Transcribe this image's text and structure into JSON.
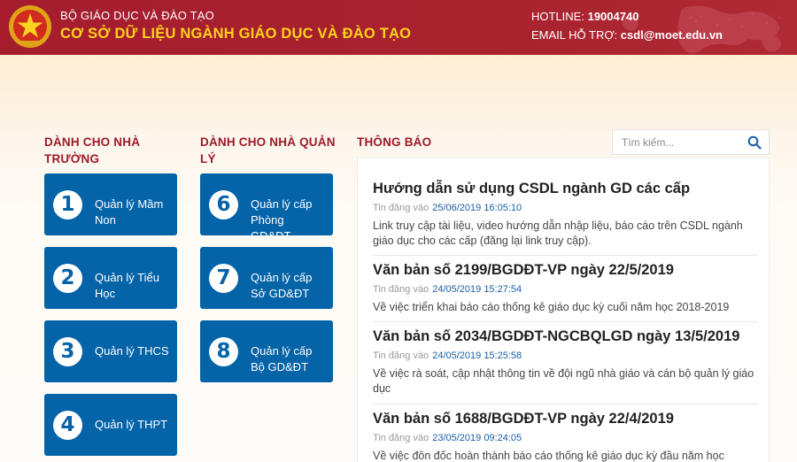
{
  "header": {
    "ministry": "BỘ GIÁO DỤC VÀ ĐÀO TẠO",
    "title": "CƠ SỞ DỮ LIỆU NGÀNH GIÁO DỤC VÀ ĐÀO TẠO",
    "hotline_label": "HOTLINE:",
    "hotline_value": "19004740",
    "email_label": "EMAIL HỖ TRỢ:",
    "email_value": "csdl@moet.edu.vn"
  },
  "schools": {
    "heading_line1": "DÀNH CHO NHÀ",
    "heading_line2": "TRƯỜNG",
    "items": [
      {
        "num": "1",
        "line1": "Quản lý Mầm",
        "line2": "Non"
      },
      {
        "num": "2",
        "line1": "Quản lý Tiểu",
        "line2": "Học"
      },
      {
        "num": "3",
        "line1": "Quản lý THCS",
        "line2": ""
      },
      {
        "num": "4",
        "line1": "Quản lý THPT",
        "line2": ""
      }
    ]
  },
  "management": {
    "heading_line1": "DÀNH CHO NHÀ QUẢN",
    "heading_line2": "LÝ",
    "items": [
      {
        "num": "6",
        "line1": "Quản lý cấp",
        "line2": "Phòng",
        "line3": "GD&ĐT"
      },
      {
        "num": "7",
        "line1": "Quản lý cấp",
        "line2": "Sở GD&ĐT"
      },
      {
        "num": "8",
        "line1": "Quản lý cấp",
        "line2": "Bộ GD&ĐT"
      }
    ]
  },
  "news": {
    "heading": "THÔNG BÁO",
    "search_placeholder": "Tìm kiếm...",
    "posted_label": "Tin đăng vào",
    "items": [
      {
        "title": "Hướng dẫn sử dụng CSDL ngành GD các cấp",
        "date": "25/06/2019 16:05:10",
        "desc_line1": "Link truy cập tài liệu, video hướng dẫn nhập liệu, báo cáo trên CSDL ngành",
        "desc_line2": "giáo dục cho các cấp (đăng lại link truy cập)."
      },
      {
        "title": "Văn bản số 2199/BGDĐT-VP ngày 22/5/2019",
        "date": "24/05/2019 15:27:54",
        "desc_line1": "Về việc triển khai báo cáo thống kê giáo dục kỳ cuối năm học 2018-2019",
        "desc_line2": ""
      },
      {
        "title": "Văn bản số 2034/BGDĐT-NGCBQLGD ngày 13/5/2019",
        "date": "24/05/2019 15:25:58",
        "desc_line1": "Về việc rà soát, cập nhật thông tin về đội ngũ nhà giáo và cán bộ quản lý giáo",
        "desc_line2": "dục"
      },
      {
        "title": "Văn bản số 1688/BGDĐT-VP ngày 22/4/2019",
        "date": "23/05/2019 09:24:05",
        "desc_line1": "Về việc đôn đốc hoàn thành báo cáo thống kê giáo dục kỳ đầu năm học",
        "desc_line2": ""
      }
    ]
  },
  "colors": {
    "header_red": "#a51d2d",
    "title_yellow": "#ffd21f",
    "tile_blue": "#0563a8",
    "heading_red": "#9b1b2a",
    "date_blue": "#1a5fa8"
  },
  "icons": {
    "emblem": "national-emblem-icon",
    "search": "search-icon",
    "map": "world-map-decoration"
  }
}
